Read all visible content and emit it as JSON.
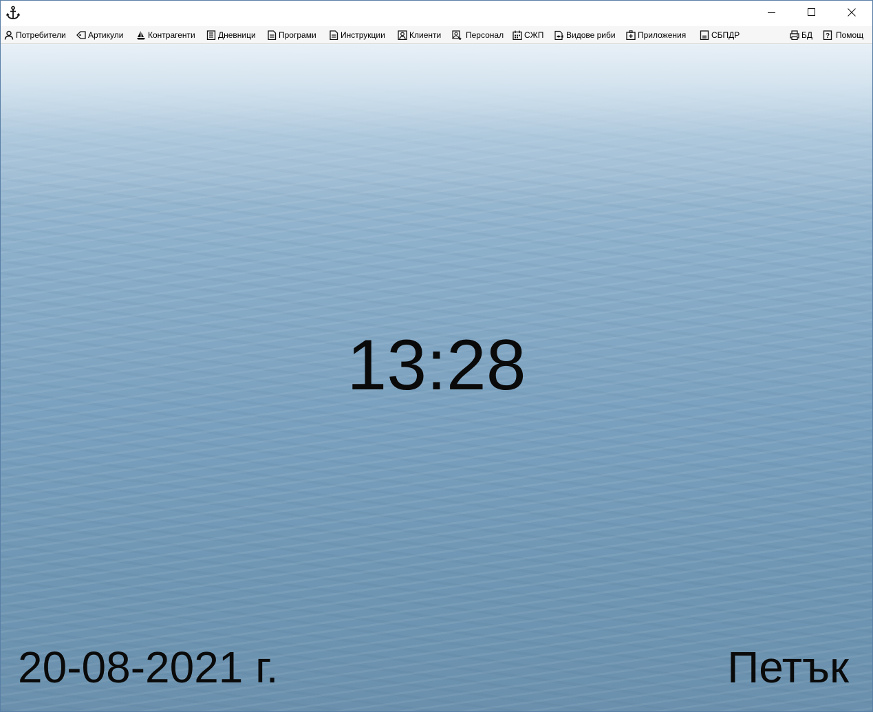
{
  "window": {
    "app_icon": "anchor-icon",
    "controls": [
      "minimize-icon",
      "maximize-icon",
      "close-icon"
    ]
  },
  "menu": {
    "items": [
      {
        "label": "Потребители",
        "icon": "user-icon"
      },
      {
        "label": "Артикули",
        "icon": "tag-icon"
      },
      {
        "label": "Контрагенти",
        "icon": "sailboat-icon"
      },
      {
        "label": "Дневници",
        "icon": "journal-icon"
      },
      {
        "label": "Програми",
        "icon": "document-icon"
      },
      {
        "label": "Инструкции",
        "icon": "document-icon"
      },
      {
        "label": "Клиенти",
        "icon": "portrait-icon"
      },
      {
        "label": "Персонал",
        "icon": "staff-icon"
      },
      {
        "label": "СЖП",
        "icon": "calendar-icon"
      },
      {
        "label": "Видове риби",
        "icon": "fish-icon"
      },
      {
        "label": "Приложения",
        "icon": "attachment-icon"
      },
      {
        "label": "СБПДР",
        "icon": "minus-box-icon"
      }
    ],
    "right_items": [
      {
        "label": "БД",
        "icon": "database-icon"
      },
      {
        "label": "Помощ",
        "icon": "help-icon"
      }
    ]
  },
  "dashboard": {
    "time": "13:28",
    "date": "20-08-2021 г.",
    "weekday": "Петък"
  }
}
